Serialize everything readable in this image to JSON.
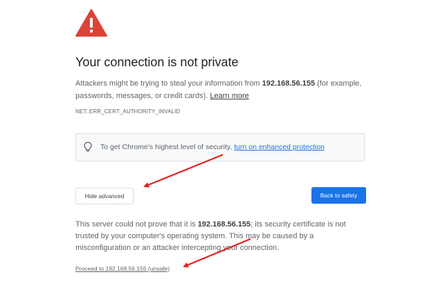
{
  "header": {
    "warning_icon": "warning-triangle-icon",
    "title": "Your connection is not private"
  },
  "description": {
    "text_before": "Attackers might be trying to steal your information from ",
    "host": "192.168.56.155",
    "text_after": " (for example, passwords, messages, or credit cards). ",
    "learn_more": "Learn more"
  },
  "error_code": "NET::ERR_CERT_AUTHORITY_INVALID",
  "tip": {
    "icon": "lightbulb-icon",
    "text": "To get Chrome's highest level of security, ",
    "link": "turn on enhanced protection"
  },
  "buttons": {
    "hide_advanced": "Hide advanced",
    "back_to_safety": "Back to safety"
  },
  "details": {
    "text_before": "This server could not prove that it is ",
    "host": "192.168.56.155",
    "text_after": "; its security certificate is not trusted by your computer's operating system. This may be caused by a misconfiguration or an attacker intercepting your connection."
  },
  "proceed_link": "Proceed to 192.168.56.155 (unsafe)",
  "colors": {
    "warning_red": "#db4437",
    "primary_blue": "#1a73e8",
    "annotation_arrow": "#e8201c"
  }
}
